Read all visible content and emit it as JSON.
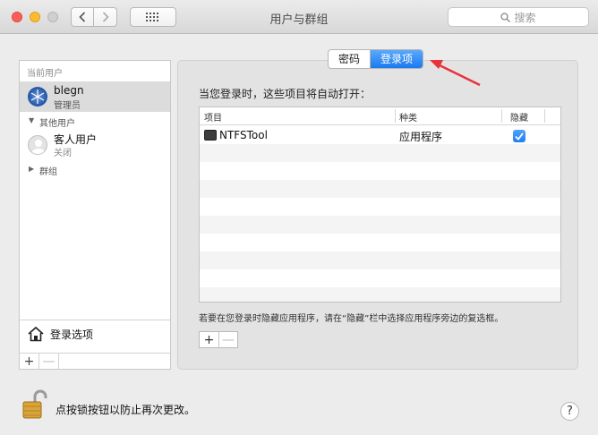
{
  "window": {
    "title": "用户与群组",
    "search_placeholder": "搜索"
  },
  "sidebar": {
    "current_users_label": "当前用户",
    "current_user": {
      "name": "blegn",
      "role": "管理员"
    },
    "other_users_label": "其他用户",
    "guest_user": {
      "name": "客人用户",
      "status": "关闭"
    },
    "groups_label": "群组",
    "login_options_label": "登录选项",
    "add_label": "+",
    "remove_label": "—"
  },
  "tabs": [
    {
      "label": "密码",
      "active": false
    },
    {
      "label": "登录项",
      "active": true
    }
  ],
  "main": {
    "intro": "当您登录时，这些项目将自动打开：",
    "columns": {
      "item": "项目",
      "kind": "种类",
      "hide": "隐藏"
    },
    "rows": [
      {
        "item": "NTFSTool",
        "kind": "应用程序",
        "hide": true
      }
    ],
    "hint": "若要在您登录时隐藏应用程序，请在“隐藏”栏中选择应用程序旁边的复选框。",
    "add_label": "+",
    "remove_label": "—"
  },
  "footer": {
    "lock_text": "点按锁按钮以防止再次更改。",
    "help_label": "?"
  },
  "colors": {
    "accent": "#1a79f0",
    "annotation_arrow": "#e8323c"
  }
}
